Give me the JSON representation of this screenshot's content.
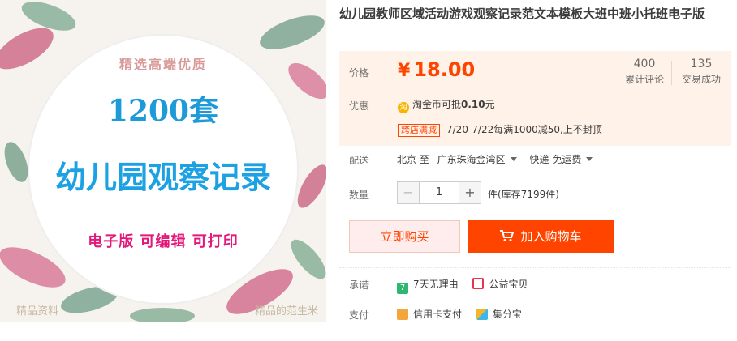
{
  "product_image": {
    "top_text": "精选高端优质",
    "count": "1200套",
    "headline": "幼儿园观察记录",
    "features": "电子版 可编辑 可打印",
    "watermark_left": "精品资料",
    "watermark_right": "精品的范生米"
  },
  "title": "幼儿园教师区域活动游戏观察记录范文本模板大班中班小托班电子版",
  "price": {
    "label": "价格",
    "currency": "¥",
    "value": "18.00",
    "reviews_count": "400",
    "reviews_label": "累计评论",
    "sales_count": "135",
    "sales_label": "交易成功"
  },
  "promo": {
    "label": "优惠",
    "coin_icon": "淘",
    "coin_text": "淘金币可抵",
    "coin_amount": "0.10",
    "coin_unit": "元",
    "tag": "跨店满减",
    "discount": "7/20-7/22每满1000减50,上不封顶"
  },
  "delivery": {
    "label": "配送",
    "from": "北京 至",
    "to": "广东珠海金湾区",
    "method": "快递 免运费"
  },
  "quantity": {
    "label": "数量",
    "minus": "−",
    "value": "1",
    "plus": "+",
    "stock": "件(库存7199件)"
  },
  "actions": {
    "buy_now": "立即购买",
    "add_to_cart": "加入购物车"
  },
  "promise": {
    "label": "承诺",
    "item1_icon": "7",
    "item1": "7天无理由",
    "item2": "公益宝贝"
  },
  "payment": {
    "label": "支付",
    "method1": "信用卡支付",
    "method2": "集分宝"
  },
  "colors": {
    "accent": "#ff4400",
    "price_bg": "#fff2e8",
    "headline_blue": "#1ca1e3",
    "feature_pink": "#e2197a"
  }
}
